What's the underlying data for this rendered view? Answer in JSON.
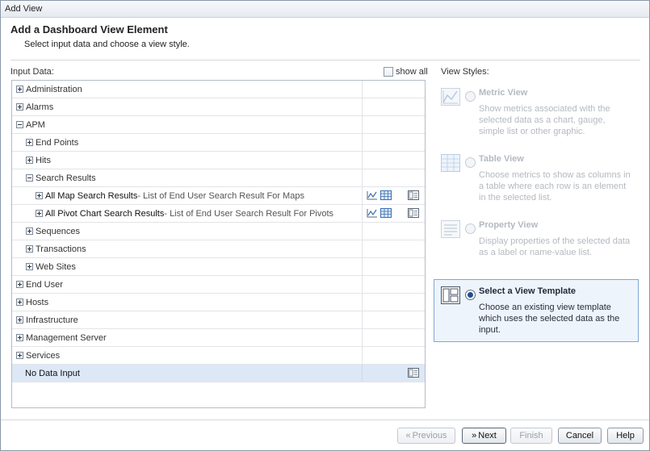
{
  "window": {
    "title": "Add View"
  },
  "header": {
    "title": "Add a Dashboard View Element",
    "subtitle": "Select input data and choose a view style."
  },
  "input_data": {
    "label": "Input Data:",
    "show_all_label": "show all",
    "show_all_checked": false,
    "rows": [
      {
        "label": "Administration",
        "toggle": "plus"
      },
      {
        "label": "Alarms",
        "toggle": "plus"
      },
      {
        "label": "APM",
        "toggle": "minus"
      },
      {
        "label": "End Points",
        "toggle": "plus"
      },
      {
        "label": "Hits",
        "toggle": "plus"
      },
      {
        "label": "Search Results",
        "toggle": "minus"
      },
      {
        "label": "All Map Search Results",
        "description": " - List of End User Search Result For Maps",
        "toggle": "plus"
      },
      {
        "label": "All Pivot Chart Search Results",
        "description": " - List of End User Search Result For Pivots",
        "toggle": "plus"
      },
      {
        "label": "Sequences",
        "toggle": "plus"
      },
      {
        "label": "Transactions",
        "toggle": "plus"
      },
      {
        "label": "Web Sites",
        "toggle": "plus"
      },
      {
        "label": "End User",
        "toggle": "plus"
      },
      {
        "label": "Hosts",
        "toggle": "plus"
      },
      {
        "label": "Infrastructure",
        "toggle": "plus"
      },
      {
        "label": "Management Server",
        "toggle": "plus"
      },
      {
        "label": "Services",
        "toggle": "plus"
      },
      {
        "label": "No Data Input",
        "selected": true
      }
    ]
  },
  "view_styles": {
    "label": "View Styles:",
    "selected": "Select a View Template",
    "options": [
      {
        "title": "Metric View",
        "description": "Show metrics associated with the selected data as a chart, gauge, simple list or other graphic.",
        "icon": "metric-chart-icon",
        "enabled": false
      },
      {
        "title": "Table View",
        "description": "Choose metrics to show as columns in a table where each row is an element in the selected list.",
        "icon": "table-icon",
        "enabled": false
      },
      {
        "title": "Property View",
        "description": "Display properties of the selected data as a label or name-value list.",
        "icon": "property-list-icon",
        "enabled": false
      },
      {
        "title": "Select a View Template",
        "description": "Choose an existing view template which uses the selected data as the input.",
        "icon": "template-icon",
        "enabled": true
      }
    ]
  },
  "footer": {
    "previous": "Previous",
    "next": "Next",
    "finish": "Finish",
    "cancel": "Cancel",
    "help": "Help"
  },
  "colors": {
    "selection": "#dde8f7",
    "template_box_border": "#7fa8d6",
    "template_box_bg": "#eef4fb"
  }
}
